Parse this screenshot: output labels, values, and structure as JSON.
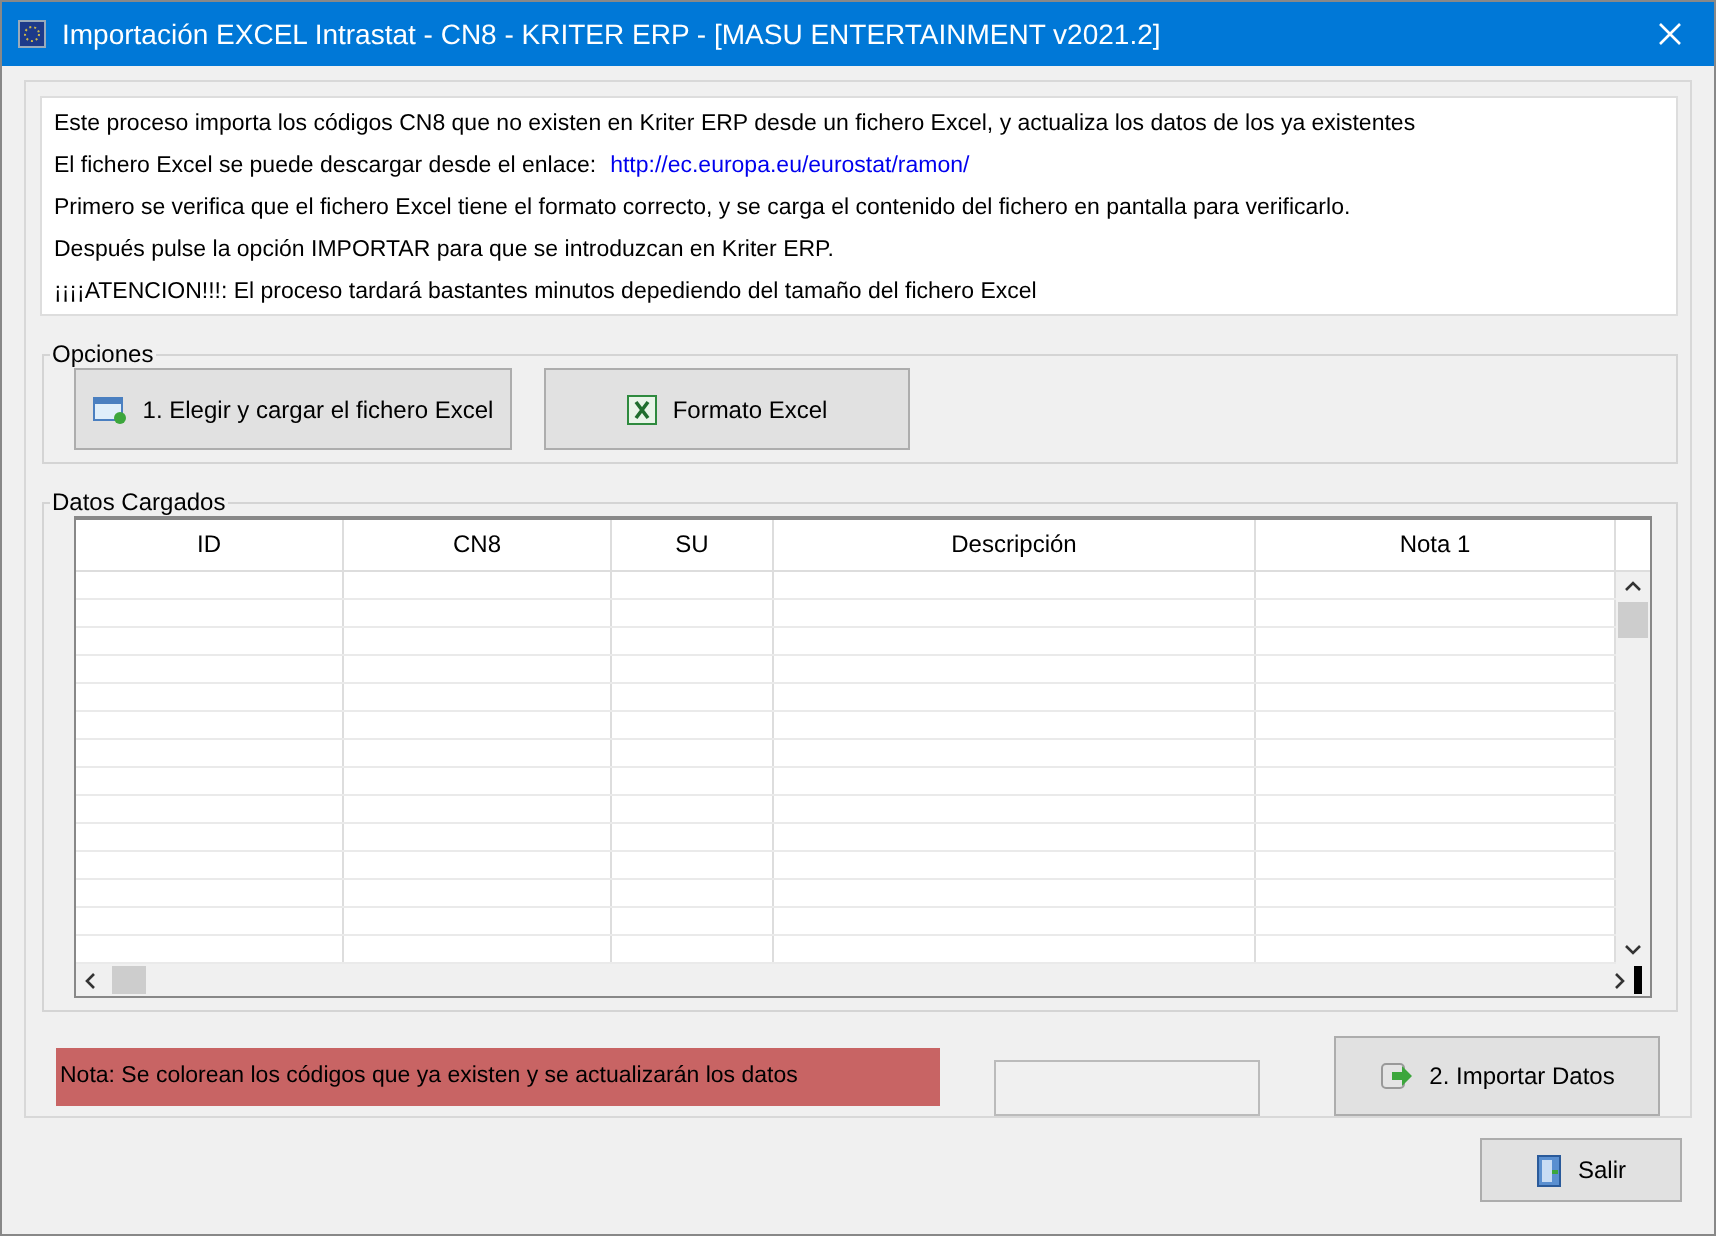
{
  "window": {
    "title": "Importación EXCEL Intrastat - CN8 - KRITER ERP - [MASU ENTERTAINMENT v2021.2]"
  },
  "info": {
    "lines": [
      {
        "kind": "text",
        "text": "Este proceso importa los códigos CN8 que no existen en Kriter ERP desde un fichero Excel, y actualiza los datos de los ya existentes"
      },
      {
        "kind": "link",
        "text": "El fichero Excel se puede descargar desde el enlace:",
        "link": "http://ec.europa.eu/eurostat/ramon/"
      },
      {
        "kind": "text",
        "text": "Primero se verifica que el fichero Excel tiene el formato correcto, y se carga el contenido del fichero en pantalla para verificarlo."
      },
      {
        "kind": "text",
        "text": "Después pulse la opción IMPORTAR para que se introduzcan en Kriter ERP."
      },
      {
        "kind": "text",
        "text": "¡¡¡¡ATENCION!!!: El proceso tardará bastantes minutos depediendo del tamaño del fichero Excel"
      }
    ]
  },
  "options": {
    "title": "Opciones",
    "buttons": [
      {
        "kind": "load",
        "label": "1. Elegir y cargar el fichero Excel"
      },
      {
        "kind": "excel",
        "label": "Formato Excel"
      }
    ]
  },
  "data": {
    "title": "Datos Cargados",
    "columns": [
      "ID",
      "CN8",
      "SU",
      "Descripción",
      "Nota 1"
    ]
  },
  "note": "Nota: Se colorean los códigos que ya existen y se actualizarán los datos",
  "import_button": "2. Importar Datos",
  "exit_button": "Salir"
}
